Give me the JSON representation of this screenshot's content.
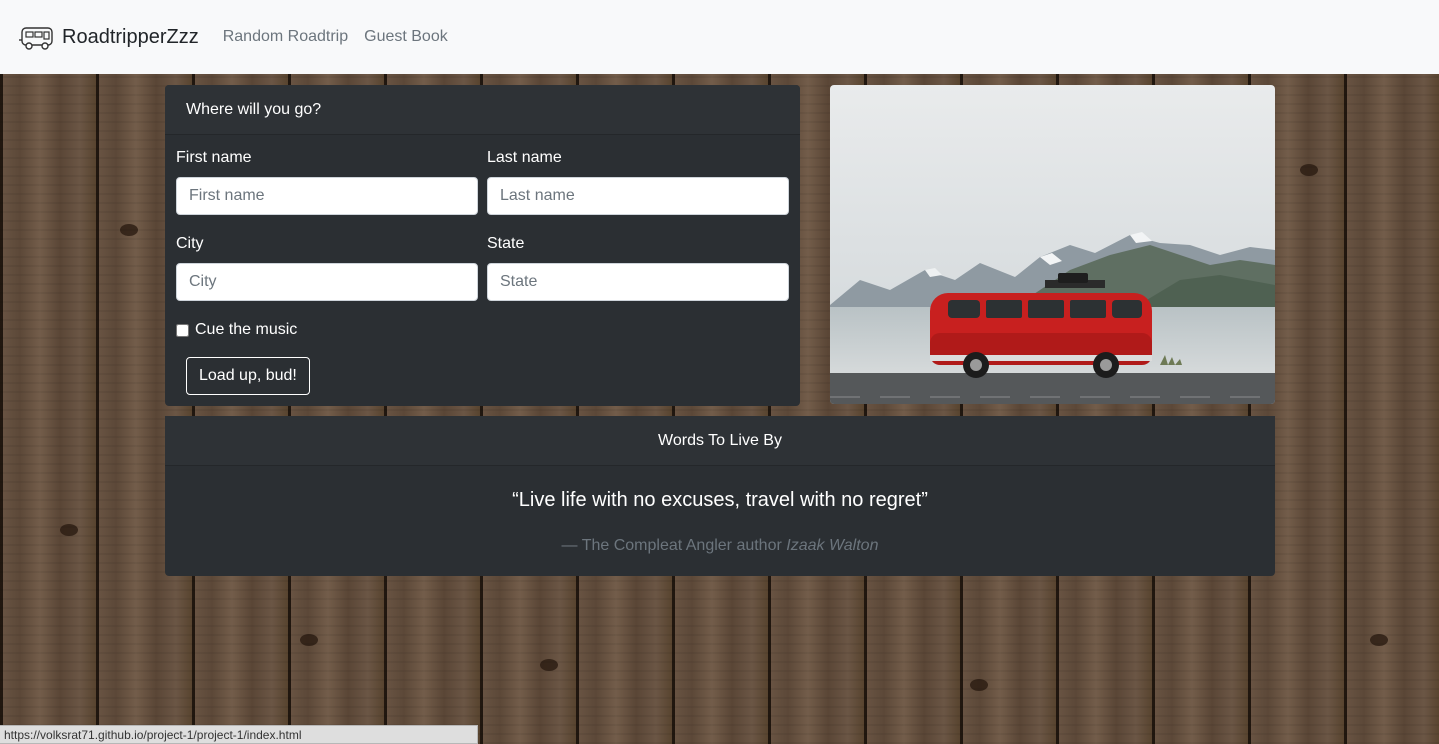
{
  "navbar": {
    "brand": "RoadtripperZzz",
    "links": [
      "Random Roadtrip",
      "Guest Book"
    ]
  },
  "form": {
    "header": "Where will you go?",
    "first_name_label": "First name",
    "first_name_placeholder": "First name",
    "last_name_label": "Last name",
    "last_name_placeholder": "Last name",
    "city_label": "City",
    "city_placeholder": "City",
    "state_label": "State",
    "state_placeholder": "State",
    "checkbox_label": "Cue the music",
    "submit_label": "Load up, bud!"
  },
  "quote": {
    "header": "Words To Live By",
    "text": "“Live life with no excuses, travel with no regret”",
    "source": "— The Compleat Angler author",
    "author": "Izaak Walton"
  },
  "statusbar": {
    "url": "https://volksrat71.github.io/project-1/project-1/index.html"
  },
  "colors": {
    "card_bg": "#2b2f33",
    "navbar_bg": "#f8f9fa",
    "van_red": "#c8201f"
  }
}
